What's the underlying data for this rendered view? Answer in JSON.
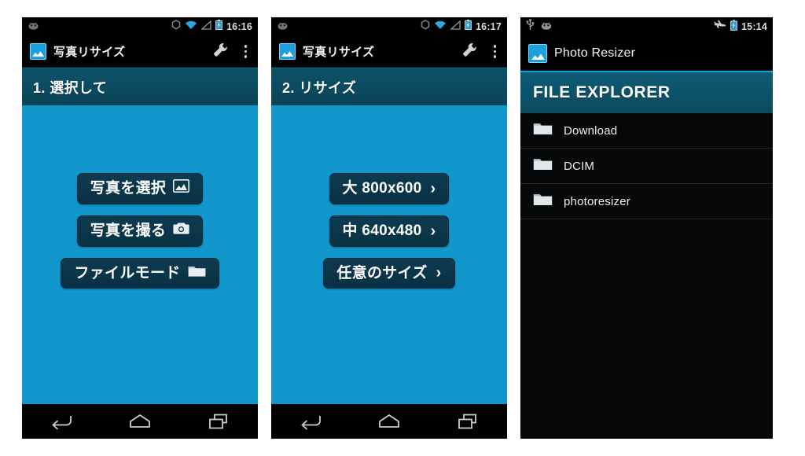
{
  "panels": [
    {
      "id": "select-photo-screen",
      "statusbar": {
        "time": "16:16",
        "icons": [
          "android-robot-icon",
          "sync-icon",
          "wifi-icon",
          "signal-icon",
          "battery-icon"
        ]
      },
      "actionbar": {
        "app_icon": "photo-resizer-app-icon",
        "title": "写真リサイズ",
        "tools_icon": "wrench-icon",
        "overflow_icon": "overflow-menu-icon"
      },
      "section": {
        "title": "1. 選択して"
      },
      "buttons": [
        {
          "label": "写真を選択",
          "icon": "image-icon",
          "chevron": false
        },
        {
          "label": "写真を撮る",
          "icon": "camera-icon",
          "chevron": false
        },
        {
          "label": "ファイルモード",
          "icon": "folder-icon",
          "chevron": false
        }
      ],
      "navbar": {
        "back": "back-icon",
        "home": "home-icon",
        "recents": "recents-icon"
      }
    },
    {
      "id": "resize-screen",
      "statusbar": {
        "time": "16:17",
        "icons": [
          "android-robot-icon",
          "sync-icon",
          "wifi-icon",
          "signal-icon",
          "battery-icon"
        ]
      },
      "actionbar": {
        "app_icon": "photo-resizer-app-icon",
        "title": "写真リサイズ",
        "tools_icon": "wrench-icon",
        "overflow_icon": "overflow-menu-icon"
      },
      "section": {
        "title": "2. リサイズ"
      },
      "buttons": [
        {
          "label": "大 800x600",
          "icon": null,
          "chevron": true
        },
        {
          "label": "中 640x480",
          "icon": null,
          "chevron": true
        },
        {
          "label": "任意のサイズ",
          "icon": null,
          "chevron": true
        }
      ],
      "navbar": {
        "back": "back-icon",
        "home": "home-icon",
        "recents": "recents-icon"
      }
    },
    {
      "id": "file-explorer-screen",
      "statusbar": {
        "time": "15:14",
        "icons": [
          "usb-icon",
          "android-robot-icon",
          "airplane-mode-icon",
          "battery-icon"
        ]
      },
      "actionbar": {
        "app_icon": "photo-resizer-app-icon",
        "title": "Photo Resizer"
      },
      "file_explorer": {
        "title": "FILE EXPLORER",
        "rows": [
          {
            "name": "Download",
            "icon": "folder-icon"
          },
          {
            "name": "DCIM",
            "icon": "folder-icon"
          },
          {
            "name": "photoresizer",
            "icon": "folder-icon"
          }
        ]
      }
    }
  ],
  "chevron_glyph": "›",
  "colors": {
    "accent_cyan": "#1197cc",
    "header_teal": "#0c5169",
    "button_navy": "#0d3b51",
    "statusbar_black": "#000000",
    "text_white": "#ffffff",
    "list_background": "#050708"
  }
}
